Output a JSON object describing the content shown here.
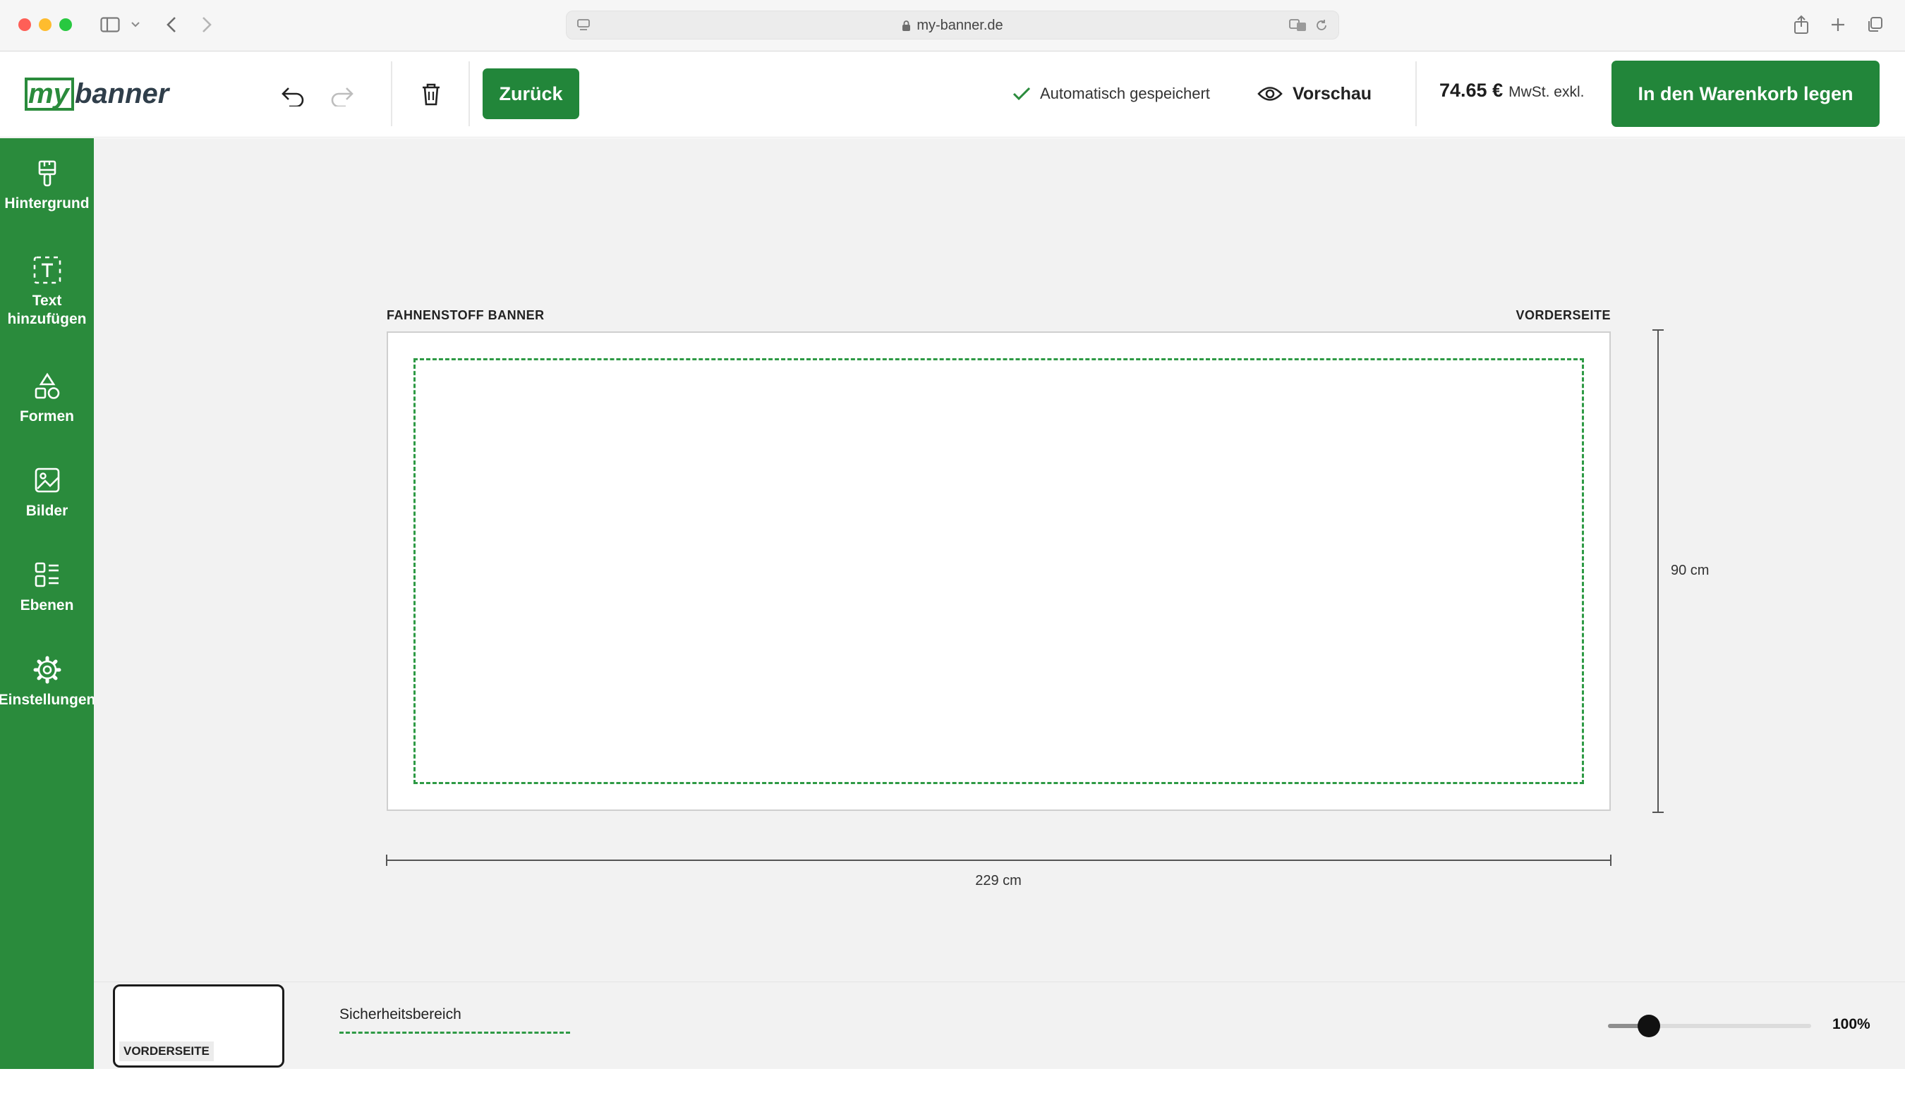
{
  "browser": {
    "url": "my-banner.de"
  },
  "header": {
    "logo_text": "mybanner",
    "back_label": "Zurück",
    "autosave_label": "Automatisch gespeichert",
    "preview_label": "Vorschau",
    "price": "74.65 €",
    "price_note": "MwSt. exkl.",
    "cart_label": "In den Warenkorb legen",
    "brand_color": "#22863a"
  },
  "sidebar": {
    "items": [
      {
        "label": "Hintergrund",
        "icon": "paintbrush-icon"
      },
      {
        "label": "Text hinzufügen",
        "icon": "text-box-icon"
      },
      {
        "label": "Formen",
        "icon": "shapes-icon"
      },
      {
        "label": "Bilder",
        "icon": "image-icon"
      },
      {
        "label": "Ebenen",
        "icon": "layers-icon"
      },
      {
        "label": "Einstellungen",
        "icon": "gear-icon"
      }
    ]
  },
  "canvas": {
    "product_label": "FAHNENSTOFF BANNER",
    "side_label": "VORDERSEITE",
    "width_label": "229 cm",
    "height_label": "90 cm"
  },
  "bottom": {
    "thumbnail_label": "VORDERSEITE",
    "safety_label": "Sicherheitsbereich",
    "zoom_label": "100%",
    "zoom_fraction": 0.2
  }
}
